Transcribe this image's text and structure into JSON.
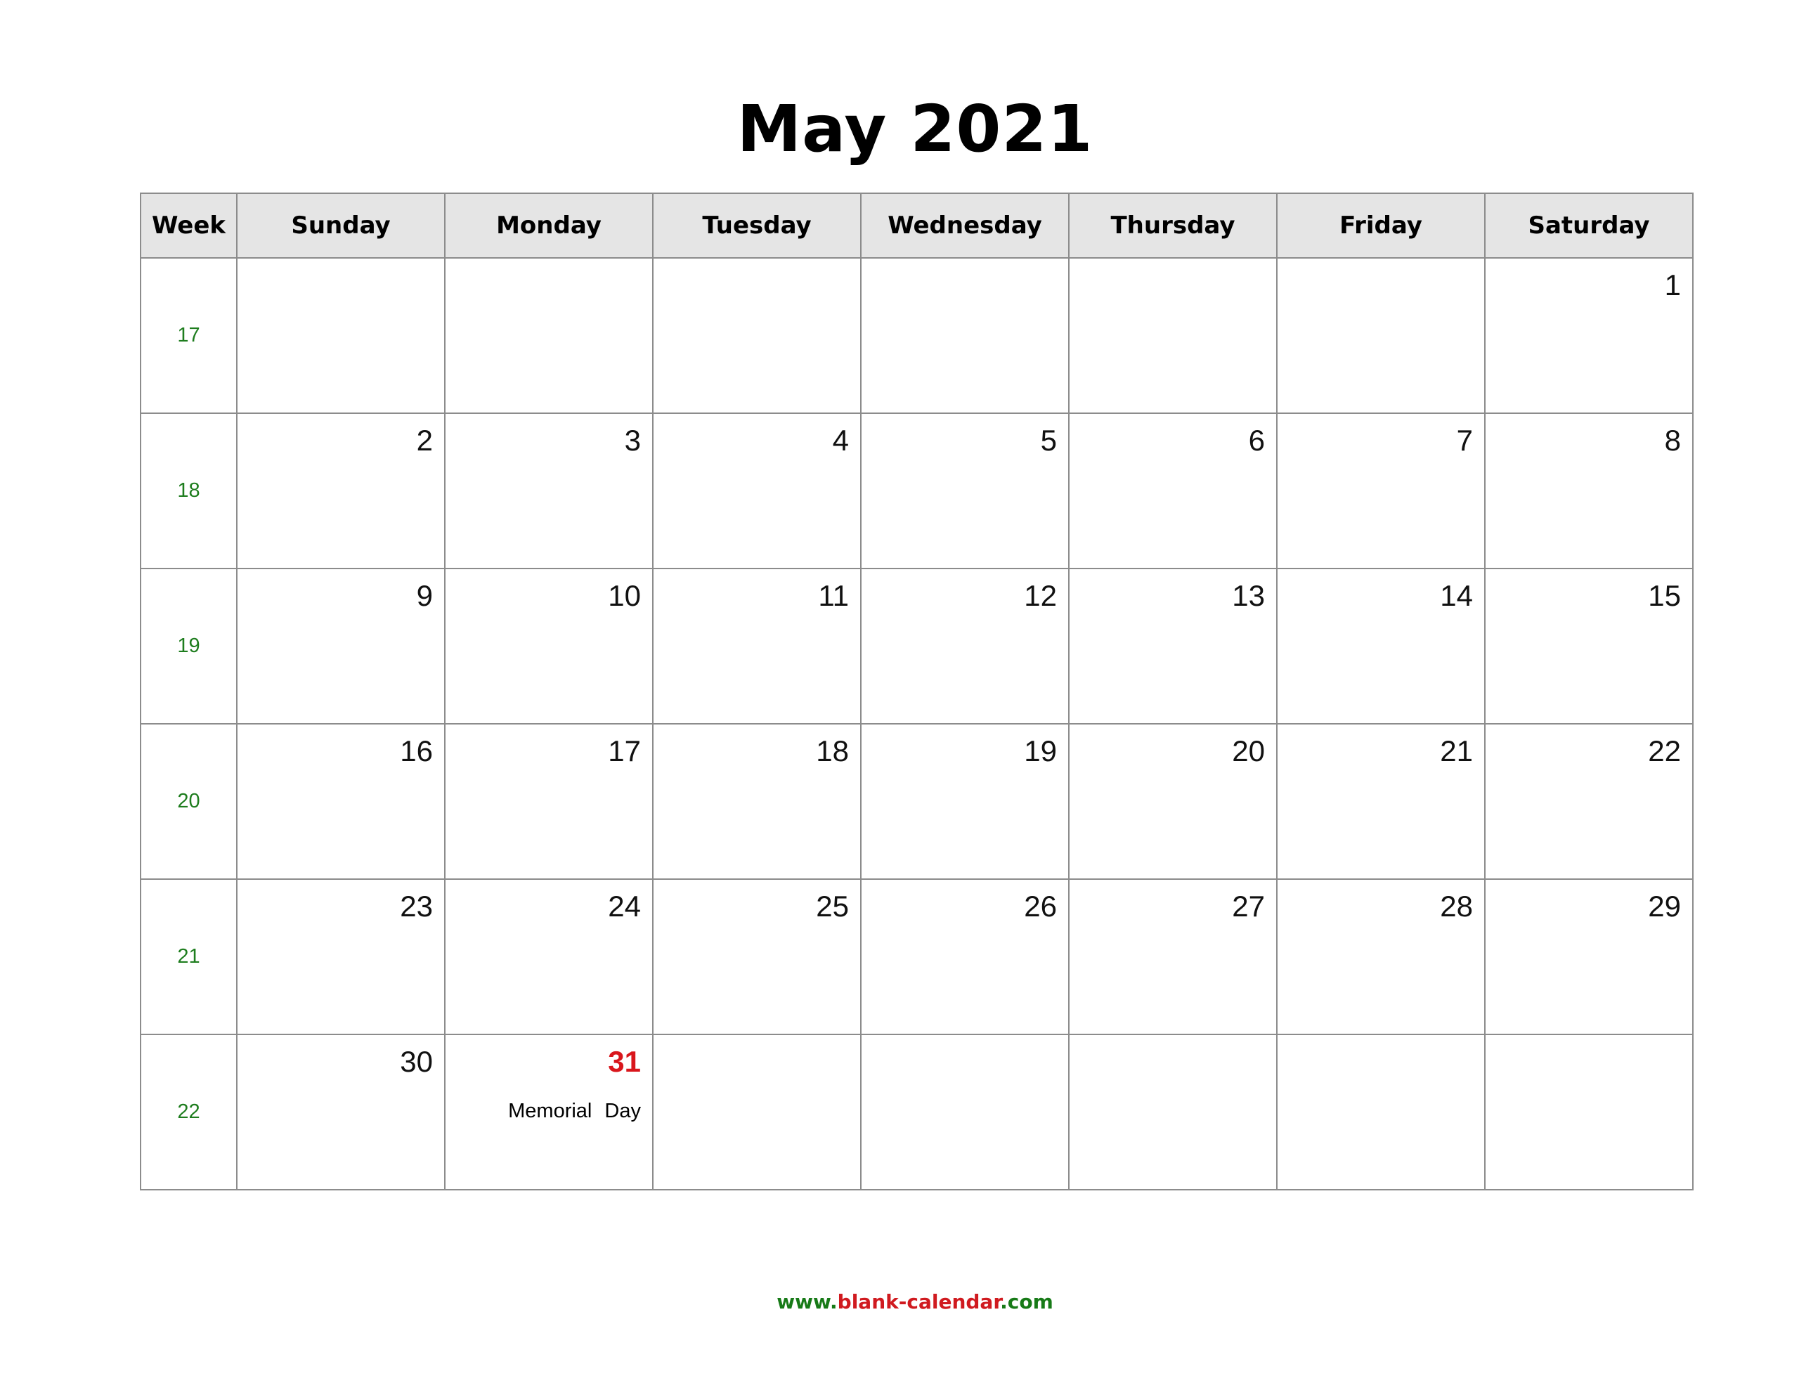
{
  "title": "May 2021",
  "header": {
    "week_label": "Week",
    "days": [
      "Sunday",
      "Monday",
      "Tuesday",
      "Wednesday",
      "Thursday",
      "Friday",
      "Saturday"
    ]
  },
  "weeks": [
    {
      "week": "17",
      "days": [
        "",
        "",
        "",
        "",
        "",
        "",
        "1"
      ]
    },
    {
      "week": "18",
      "days": [
        "2",
        "3",
        "4",
        "5",
        "6",
        "7",
        "8"
      ]
    },
    {
      "week": "19",
      "days": [
        "9",
        "10",
        "11",
        "12",
        "13",
        "14",
        "15"
      ]
    },
    {
      "week": "20",
      "days": [
        "16",
        "17",
        "18",
        "19",
        "20",
        "21",
        "22"
      ]
    },
    {
      "week": "21",
      "days": [
        "23",
        "24",
        "25",
        "26",
        "27",
        "28",
        "29"
      ]
    },
    {
      "week": "22",
      "days": [
        "30",
        "31",
        "",
        "",
        "",
        "",
        ""
      ]
    }
  ],
  "holidays": [
    {
      "week_index": 5,
      "day_index": 1,
      "date": "31",
      "name": "Memorial Day",
      "color": "#d9161c"
    }
  ],
  "colors": {
    "week_number": "#1e7d1e",
    "header_bg": "#e5e5e5",
    "grid": "#8c8c8c",
    "holiday": "#d9161c",
    "footer_green": "#177a17",
    "footer_red": "#d01a1f"
  },
  "footer": {
    "prefix": "www.",
    "domain": "blank-calendar",
    "suffix": ".com"
  }
}
